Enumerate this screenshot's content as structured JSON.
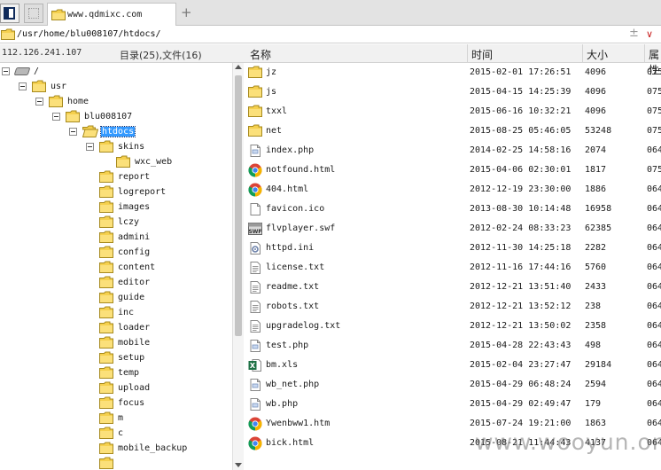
{
  "tabs": [
    {
      "label": "www.qdmixc.com"
    }
  ],
  "address": {
    "path": "/usr/home/blu008107/htdocs/"
  },
  "info": {
    "ip": "112.126.241.107",
    "count": "目录(25),文件(16)"
  },
  "columns": {
    "name": "名称",
    "time": "时间",
    "size": "大小",
    "perm": "属性"
  },
  "tree": [
    {
      "label": "/",
      "level": 0,
      "expanded": true,
      "icon": "drive-icon"
    },
    {
      "label": "usr",
      "level": 1,
      "expanded": true
    },
    {
      "label": "home",
      "level": 2,
      "expanded": true
    },
    {
      "label": "blu008107",
      "level": 3,
      "expanded": true
    },
    {
      "label": "htdocs",
      "level": 4,
      "expanded": true,
      "selected": true,
      "open": true
    },
    {
      "label": "skins",
      "level": 5,
      "expanded": true
    },
    {
      "label": "wxc_web",
      "level": 6
    },
    {
      "label": "report",
      "level": 5
    },
    {
      "label": "logreport",
      "level": 5
    },
    {
      "label": "images",
      "level": 5
    },
    {
      "label": "lczy",
      "level": 5
    },
    {
      "label": "admini",
      "level": 5
    },
    {
      "label": "config",
      "level": 5
    },
    {
      "label": "content",
      "level": 5
    },
    {
      "label": "editor",
      "level": 5
    },
    {
      "label": "guide",
      "level": 5
    },
    {
      "label": "inc",
      "level": 5
    },
    {
      "label": "loader",
      "level": 5
    },
    {
      "label": "mobile",
      "level": 5
    },
    {
      "label": "setup",
      "level": 5
    },
    {
      "label": "temp",
      "level": 5
    },
    {
      "label": "upload",
      "level": 5
    },
    {
      "label": "focus",
      "level": 5
    },
    {
      "label": "m",
      "level": 5
    },
    {
      "label": "c",
      "level": 5
    },
    {
      "label": "mobile_backup",
      "level": 5
    },
    {
      "label": "",
      "level": 5
    }
  ],
  "files": [
    {
      "name": "jz",
      "time": "2015-02-01 17:26:51",
      "size": "4096",
      "perm": "075",
      "icon": "folder-icon"
    },
    {
      "name": "js",
      "time": "2015-04-15 14:25:39",
      "size": "4096",
      "perm": "075",
      "icon": "folder-icon"
    },
    {
      "name": "txxl",
      "time": "2015-06-16 10:32:21",
      "size": "4096",
      "perm": "075",
      "icon": "folder-icon"
    },
    {
      "name": "net",
      "time": "2015-08-25 05:46:05",
      "size": "53248",
      "perm": "075",
      "icon": "folder-icon"
    },
    {
      "name": "index.php",
      "time": "2014-02-25 14:58:16",
      "size": "2074",
      "perm": "064",
      "icon": "file-icon"
    },
    {
      "name": "notfound.html",
      "time": "2015-04-06 02:30:01",
      "size": "1817",
      "perm": "075",
      "icon": "chrome-icon"
    },
    {
      "name": "404.html",
      "time": "2012-12-19 23:30:00",
      "size": "1886",
      "perm": "064",
      "icon": "chrome-icon"
    },
    {
      "name": "favicon.ico",
      "time": "2013-08-30 10:14:48",
      "size": "16958",
      "perm": "064",
      "icon": "blank-file-icon"
    },
    {
      "name": "flvplayer.swf",
      "time": "2012-02-24 08:33:23",
      "size": "62385",
      "perm": "064",
      "icon": "swf-icon"
    },
    {
      "name": "httpd.ini",
      "time": "2012-11-30 14:25:18",
      "size": "2282",
      "perm": "064",
      "icon": "ini-icon"
    },
    {
      "name": "license.txt",
      "time": "2012-11-16 17:44:16",
      "size": "5760",
      "perm": "064",
      "icon": "text-file-icon"
    },
    {
      "name": "readme.txt",
      "time": "2012-12-21 13:51:40",
      "size": "2433",
      "perm": "064",
      "icon": "text-file-icon"
    },
    {
      "name": "robots.txt",
      "time": "2012-12-21 13:52:12",
      "size": "238",
      "perm": "064",
      "icon": "text-file-icon"
    },
    {
      "name": "upgradelog.txt",
      "time": "2012-12-21 13:50:02",
      "size": "2358",
      "perm": "064",
      "icon": "text-file-icon"
    },
    {
      "name": "test.php",
      "time": "2015-04-28 22:43:43",
      "size": "498",
      "perm": "064",
      "icon": "file-icon"
    },
    {
      "name": "bm.xls",
      "time": "2015-02-04 23:27:47",
      "size": "29184",
      "perm": "064",
      "icon": "excel-icon"
    },
    {
      "name": "wb_net.php",
      "time": "2015-04-29 06:48:24",
      "size": "2594",
      "perm": "064",
      "icon": "file-icon"
    },
    {
      "name": "wb.php",
      "time": "2015-04-29 02:49:47",
      "size": "179",
      "perm": "064",
      "icon": "file-icon"
    },
    {
      "name": "Ywenbww1.htm",
      "time": "2015-07-24 19:21:00",
      "size": "1863",
      "perm": "064",
      "icon": "chrome-icon"
    },
    {
      "name": "bick.html",
      "time": "2015-08-21 11:44:43",
      "size": "4137",
      "perm": "064",
      "icon": "chrome-icon"
    }
  ],
  "watermark": "www.wooyun.org"
}
